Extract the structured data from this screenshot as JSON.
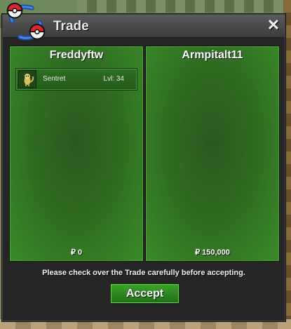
{
  "window": {
    "title": "Trade",
    "close_icon": "close-icon"
  },
  "left_panel": {
    "player_name": "Freddyftw",
    "items": [
      {
        "icon": "sentret-sprite-icon",
        "name": "Sentret",
        "level": "Lvl: 34"
      }
    ],
    "money": "₽ 0"
  },
  "right_panel": {
    "player_name": "Armpitalt11",
    "money": "₽ 150,000"
  },
  "notice": "Please check over the Trade carefully before accepting.",
  "accept_label": "Accept",
  "colors": {
    "panel_green": "#2f6b22",
    "accent_green": "#3da32c",
    "window_bg": "#262626"
  }
}
